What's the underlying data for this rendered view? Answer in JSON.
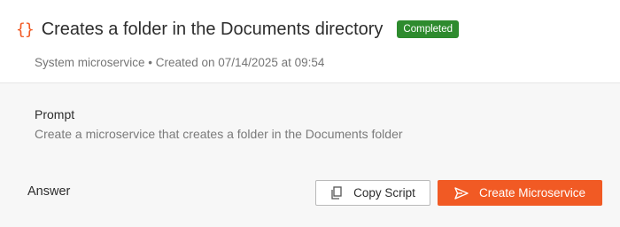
{
  "header": {
    "icon": "curly-braces-icon",
    "brace_glyph": "{}",
    "title": "Creates a folder in the Documents directory",
    "status_badge": "Completed",
    "meta": "System microservice • Created on 07/14/2025 at 09:54"
  },
  "prompt": {
    "label": "Prompt",
    "text": "Create a microservice that creates a folder in the Documents folder"
  },
  "answer": {
    "label": "Answer",
    "copy_button": {
      "label": "Copy Script",
      "icon": "copy-icon"
    },
    "create_button": {
      "label": "Create Microservice",
      "icon": "send-icon"
    }
  },
  "colors": {
    "accent": "#f15a24",
    "badge_green": "#2e8b2e",
    "panel_bg": "#f7f7f7"
  }
}
